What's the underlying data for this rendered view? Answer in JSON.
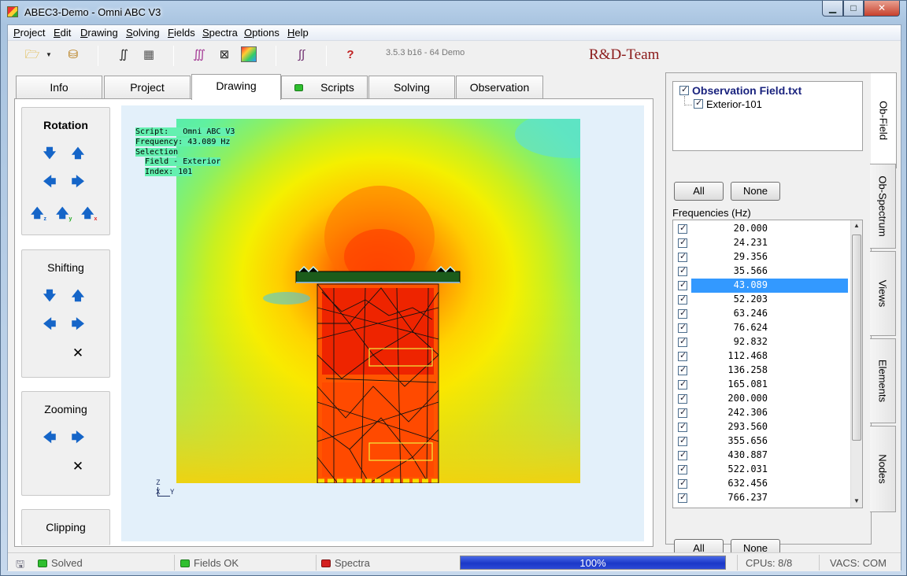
{
  "window": {
    "title": "ABEC3-Demo - Omni ABC V3",
    "min": "▁",
    "max": "□",
    "close": "✕"
  },
  "menu": [
    "Project",
    "Edit",
    "Drawing",
    "Solving",
    "Fields",
    "Spectra",
    "Options",
    "Help"
  ],
  "toolbar": {
    "icons": [
      "open-folder-icon",
      "dropdown-arrow-icon",
      "save-project-icon",
      "integral-icon",
      "mesh-icon",
      "integral-color-icon",
      "wireframe-icon",
      "colormap-icon",
      "spectrum-icon",
      "help-icon"
    ],
    "version": "3.5.3 b16 - 64 Demo",
    "team": "R&D-Team"
  },
  "tabs": [
    "Info",
    "Project",
    "Drawing",
    "Scripts",
    "Solving",
    "Observation"
  ],
  "active_tab": "Drawing",
  "controls": {
    "rotation": "Rotation",
    "shifting": "Shifting",
    "zooming": "Zooming",
    "clipping": "Clipping"
  },
  "viewport": {
    "info": {
      "script_label": "Script:",
      "script_value": "Omni ABC V3",
      "freq_label": "Frequency:",
      "freq_value": "43.089 Hz",
      "selection_label": "Selection",
      "field_line": "Field - Exterior",
      "index_line": "Index: 101"
    },
    "axes": {
      "z": "Z",
      "x": "X",
      "y": "Y"
    }
  },
  "observation": {
    "file": "Observation Field.txt",
    "child": "Exterior-101",
    "all": "All",
    "none": "None",
    "freq_label": "Frequencies  (Hz)",
    "frequencies": [
      "20.000",
      "24.231",
      "29.356",
      "35.566",
      "43.089",
      "52.203",
      "63.246",
      "76.624",
      "92.832",
      "112.468",
      "136.258",
      "165.081",
      "200.000",
      "242.306",
      "293.560",
      "355.656",
      "430.887",
      "522.031",
      "632.456",
      "766.237"
    ],
    "selected": "43.089"
  },
  "side_tabs": [
    "Ob-Field",
    "Ob-Spectrum",
    "Views",
    "Elements",
    "Nodes"
  ],
  "status": {
    "solved": "Solved",
    "fields": "Fields OK",
    "spectra": "Spectra",
    "progress_pct": 100,
    "progress_text": "100%",
    "cpus": "CPUs: 8/8",
    "vacs": "VACS: COM"
  },
  "colors": {
    "led_green": "#2fbf2f",
    "led_red": "#d42020",
    "progress": "#1b38c8",
    "selection": "#3399ff",
    "team": "#8b1a1a"
  }
}
